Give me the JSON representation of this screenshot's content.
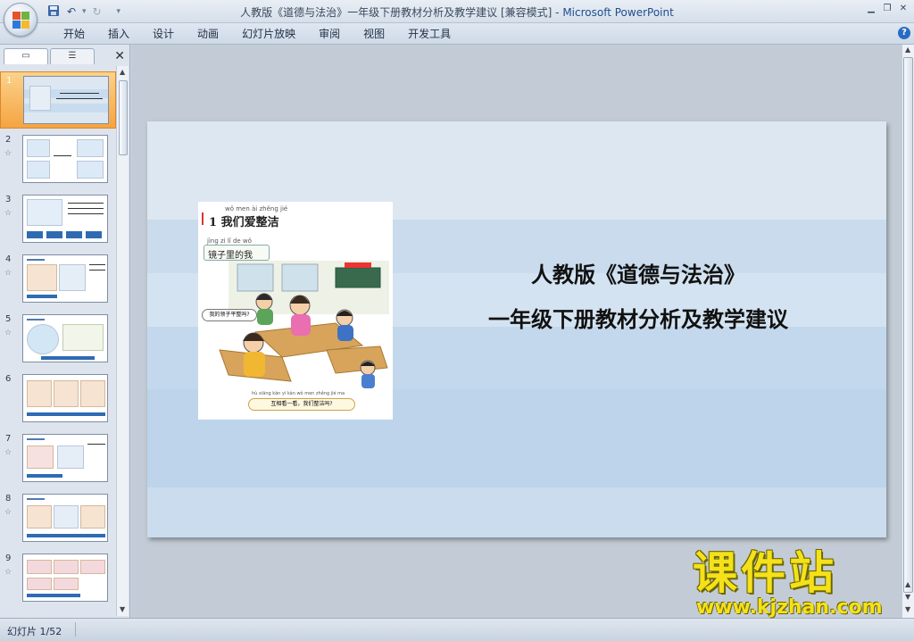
{
  "window": {
    "title_doc": "人教版《道德与法治》一年级下册教材分析及教学建议 [兼容模式] - ",
    "title_app": "Microsoft PowerPoint"
  },
  "ribbon": {
    "tabs": [
      "开始",
      "插入",
      "设计",
      "动画",
      "幻灯片放映",
      "审阅",
      "视图",
      "开发工具"
    ]
  },
  "thumbnails": {
    "items": [
      {
        "num": "1",
        "selected": true
      },
      {
        "num": "2",
        "selected": false
      },
      {
        "num": "3",
        "selected": false
      },
      {
        "num": "4",
        "selected": false
      },
      {
        "num": "5",
        "selected": false
      },
      {
        "num": "6",
        "selected": false
      },
      {
        "num": "7",
        "selected": false
      },
      {
        "num": "8",
        "selected": false
      },
      {
        "num": "9",
        "selected": false
      }
    ]
  },
  "slide": {
    "title_line1": "人教版《道德与法治》",
    "title_line2": "一年级下册教材分析及教学建议",
    "book": {
      "lesson_num": "1",
      "lesson_title": "我们爱整洁",
      "lesson_pinyin": "wǒ  men  ài  zhěng  jié",
      "sub_pinyin": "jìng  zi  lǐ   de   wǒ",
      "sub_title": "镜子里的我",
      "speech1": "我的领子平整吗?",
      "speech2": "互相看一看，我们整洁吗?",
      "speech2_pinyin": "hù xiāng kàn yi kàn  wǒ men zhěng jié ma"
    }
  },
  "status": {
    "slide_indicator": "幻灯片 1/52"
  },
  "watermark": {
    "cn": "课件站",
    "url": "www.kjzhan.com"
  },
  "colors": {
    "selected_thumb": "#f5a442",
    "slide_band": "#c3d8ec",
    "watermark": "#f4e11a"
  }
}
